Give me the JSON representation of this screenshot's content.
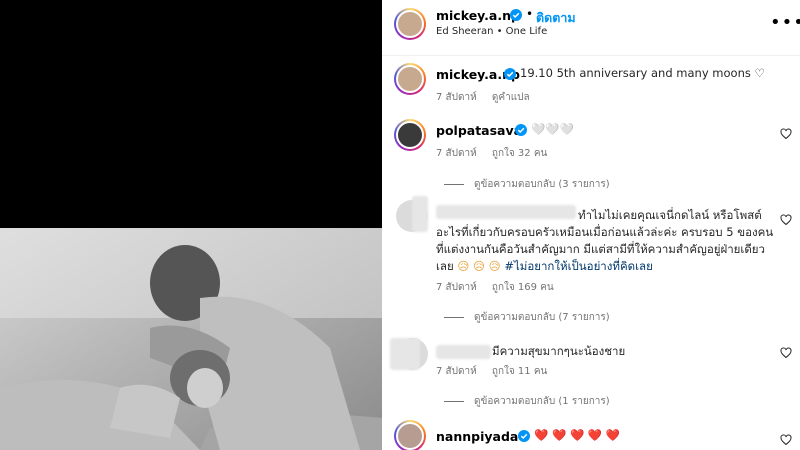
{
  "post": {
    "author": "mickey.a.np",
    "follow_label": "ติดตาม",
    "audio": "Ed Sheeran • One Life",
    "caption_author": "mickey.a.np",
    "caption": "19.10 5th anniversary and many moons ♡",
    "caption_time": "7 สัปดาห์",
    "caption_translate": "ดูคำแปล"
  },
  "comments": [
    {
      "user": "polpatasava",
      "text": "🤍🤍🤍",
      "time": "7 สัปดาห์",
      "likes": "ถูกใจ 32 คน",
      "replies": "ดูข้อความตอบกลับ (3 รายการ)"
    },
    {
      "user": "",
      "lines": [
        "ทำไมไม่เคยคุณเจนี่กดไลน์ หรือโพสต์",
        "อะไรที่เกี่ยวกับครอบครัวเหมือนเมื่อก่อนแล้วล่ะค่ะ ครบรอบ 5 ของคน",
        "ที่แต่งงานกันคือวันสำคัญมาก มีแต่สามีที่ให้ความสำคัญอยู่ฝ่ายเดียว",
        "เลย"
      ],
      "emoji": "😥 😥 😥",
      "hashtag": "#ไม่อยากให้เป็นอย่างที่คิดเลย",
      "time": "7 สัปดาห์",
      "likes": "ถูกใจ 169 คน",
      "replies": "ดูข้อความตอบกลับ (7 รายการ)"
    },
    {
      "user": "",
      "text": "มีความสุขมากๆนะน้องชาย",
      "time": "7 สัปดาห์",
      "likes": "ถูกใจ 11 คน",
      "replies": "ดูข้อความตอบกลับ (1 รายการ)"
    },
    {
      "user": "nannpiyada",
      "text": "❤️ ❤️ ❤️ ❤️ ❤️"
    }
  ],
  "colors": {
    "accent": "#0095f6",
    "verified": "#0095f6",
    "muted": "#737373"
  }
}
